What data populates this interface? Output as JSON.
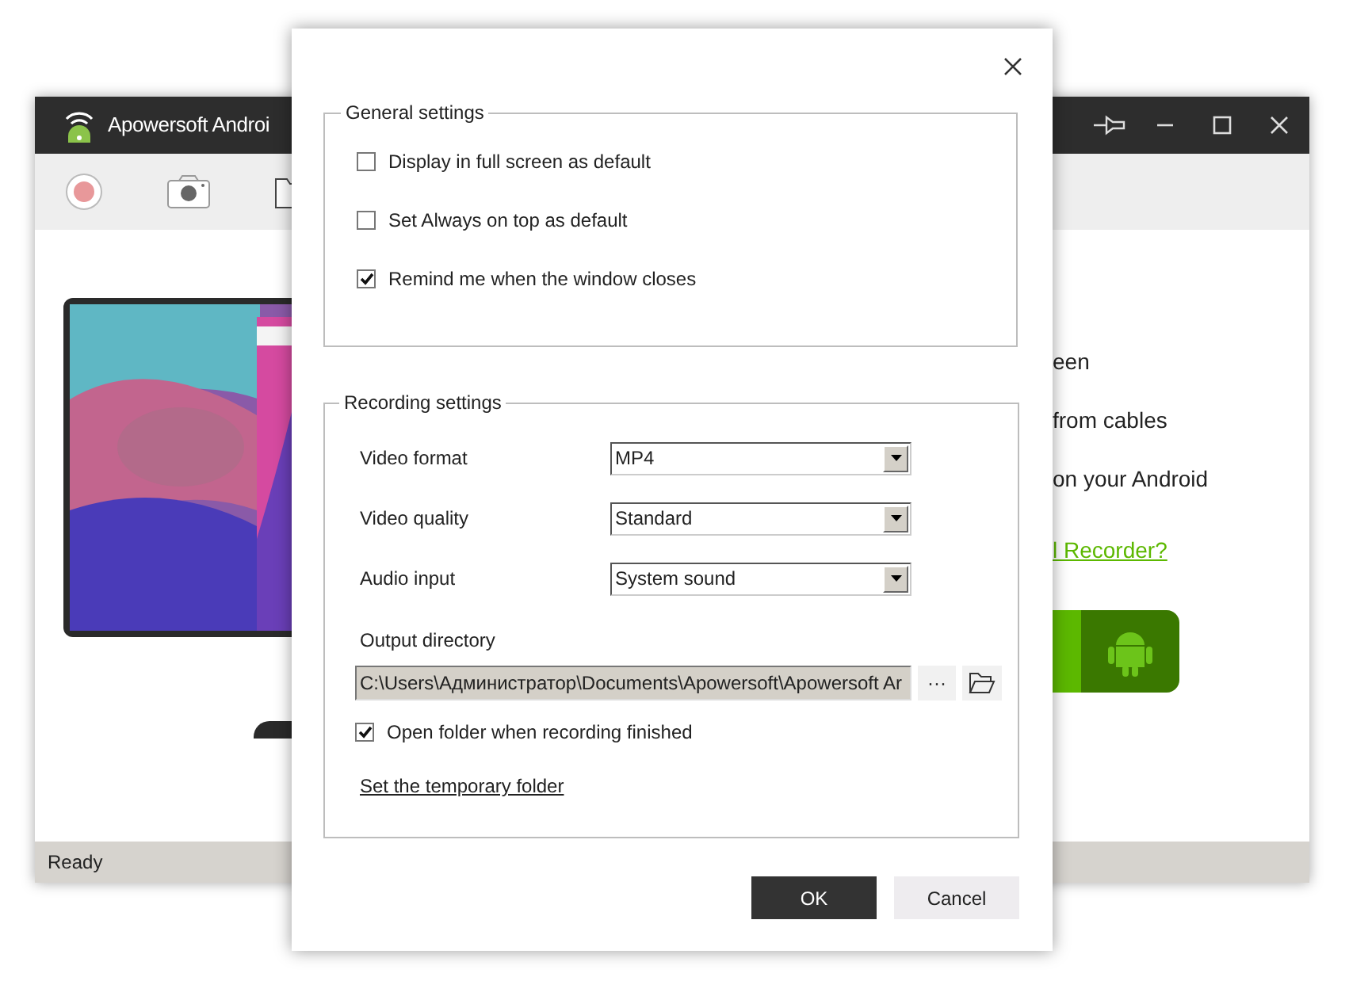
{
  "main_window": {
    "title": "Apowersoft Androi",
    "features": [
      "een",
      "from cables",
      "on your Android"
    ],
    "help_link": "l Recorder?",
    "status_bar": "Ready"
  },
  "dialog": {
    "general_settings": {
      "title": "General settings",
      "options": [
        {
          "label": "Display in full screen as default",
          "checked": false
        },
        {
          "label": "Set Always on top as default",
          "checked": false
        },
        {
          "label": "Remind me when the window closes",
          "checked": true
        }
      ]
    },
    "recording_settings": {
      "title": "Recording settings",
      "fields": [
        {
          "label": "Video format",
          "value": "MP4"
        },
        {
          "label": "Video quality",
          "value": "Standard"
        },
        {
          "label": "Audio input",
          "value": "System sound"
        }
      ],
      "output_directory": {
        "label": "Output directory",
        "value": "C:\\Users\\Администратор\\Documents\\Apowersoft\\Apowersoft Ar",
        "browse_button": "···"
      },
      "open_folder": {
        "label": "Open folder when recording finished",
        "checked": true
      },
      "temp_folder_link": "Set the temporary folder"
    },
    "buttons": [
      {
        "label": "OK",
        "kind": "primary"
      },
      {
        "label": "Cancel",
        "kind": "secondary"
      }
    ]
  }
}
